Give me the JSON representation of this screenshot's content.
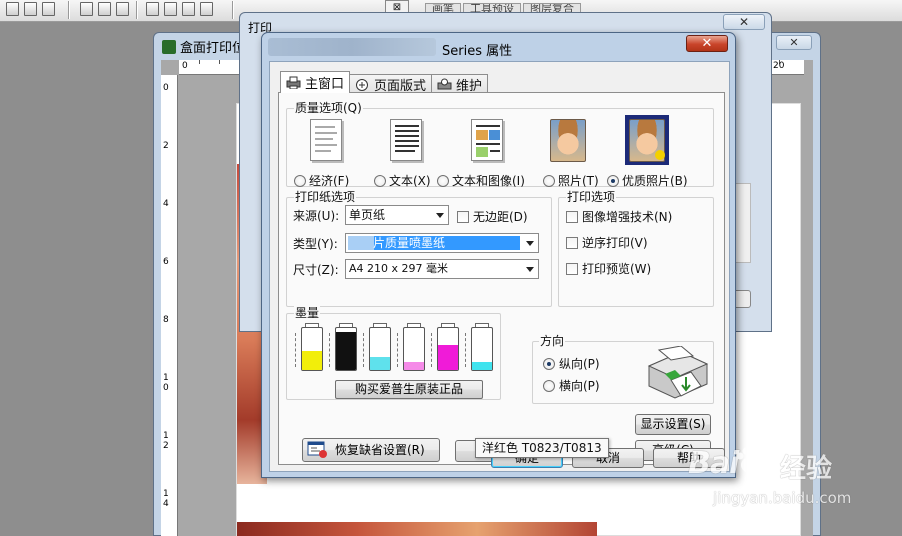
{
  "background_app": {
    "window_title": "盒面打印位",
    "tabs": [
      "画笔",
      "工具预设",
      "图层复合"
    ],
    "ruler_top": [
      "0",
      "20"
    ],
    "ruler_left": [
      "0",
      "2",
      "4",
      "6",
      "8",
      "1 0",
      "1 2",
      "1 4"
    ]
  },
  "print_window": {
    "title": "打印",
    "close_glyph": "✕"
  },
  "dialog": {
    "title": "Series 属性",
    "close_glyph": "✕",
    "tabs": [
      {
        "label": "主窗口",
        "icon": "printer-icon",
        "active": true
      },
      {
        "label": "页面版式",
        "icon": "page-layout-icon",
        "active": false
      },
      {
        "label": "维护",
        "icon": "maintenance-icon",
        "active": false
      }
    ],
    "quality": {
      "group_label": "质量选项(Q)",
      "options": [
        {
          "label": "经济(F)",
          "icon": "economy-doc-icon",
          "selected": false
        },
        {
          "label": "文本(X)",
          "icon": "text-doc-icon",
          "selected": false
        },
        {
          "label": "文本和图像(I)",
          "icon": "text-image-doc-icon",
          "selected": false
        },
        {
          "label": "照片(T)",
          "icon": "photo-icon",
          "selected": false
        },
        {
          "label": "优质照片(B)",
          "icon": "best-photo-icon",
          "selected": true
        }
      ]
    },
    "paper": {
      "group_label": "打印纸选项",
      "source_label": "来源(U):",
      "source_value": "单页纸",
      "borderless_label": "无边距(D)",
      "type_label": "类型(Y):",
      "type_value": "片质量喷墨纸",
      "size_label": "尺寸(Z):",
      "size_value": "A4 210 x 297 毫米"
    },
    "print_options": {
      "group_label": "打印选项",
      "items": [
        "图像增强技术(N)",
        "逆序打印(V)",
        "打印预览(W)"
      ]
    },
    "ink": {
      "group_label": "墨量",
      "cartridges": [
        {
          "color": "yellow",
          "hex": "#f2ee0a",
          "level": 0.45
        },
        {
          "color": "black",
          "hex": "#111111",
          "level": 0.9
        },
        {
          "color": "light cyan",
          "hex": "#5fe1ec",
          "level": 0.3
        },
        {
          "color": "light magenta",
          "hex": "#f58ae8",
          "level": 0.2
        },
        {
          "color": "magenta",
          "hex": "#f01bd8",
          "level": 0.6
        },
        {
          "color": "cyan",
          "hex": "#3fe3ee",
          "level": 0.2
        }
      ],
      "buy_button": "购买爱普生原装正品"
    },
    "tooltip": "洋红色 T0823/T0813",
    "orientation": {
      "group_label": "方向",
      "portrait": "纵向(P)",
      "landscape": "横向(P)",
      "selected": "portrait"
    },
    "buttons": {
      "restore": "恢复缺省设置(R)",
      "support": "技术支持",
      "show_settings": "显示设置(S)",
      "advanced": "高级(C)",
      "ok": "确定",
      "cancel": "取消",
      "help": "帮助"
    }
  },
  "watermark": {
    "logo": "Bai",
    "logo_suffix": "经验",
    "url": "jingyan.baidu.com"
  }
}
